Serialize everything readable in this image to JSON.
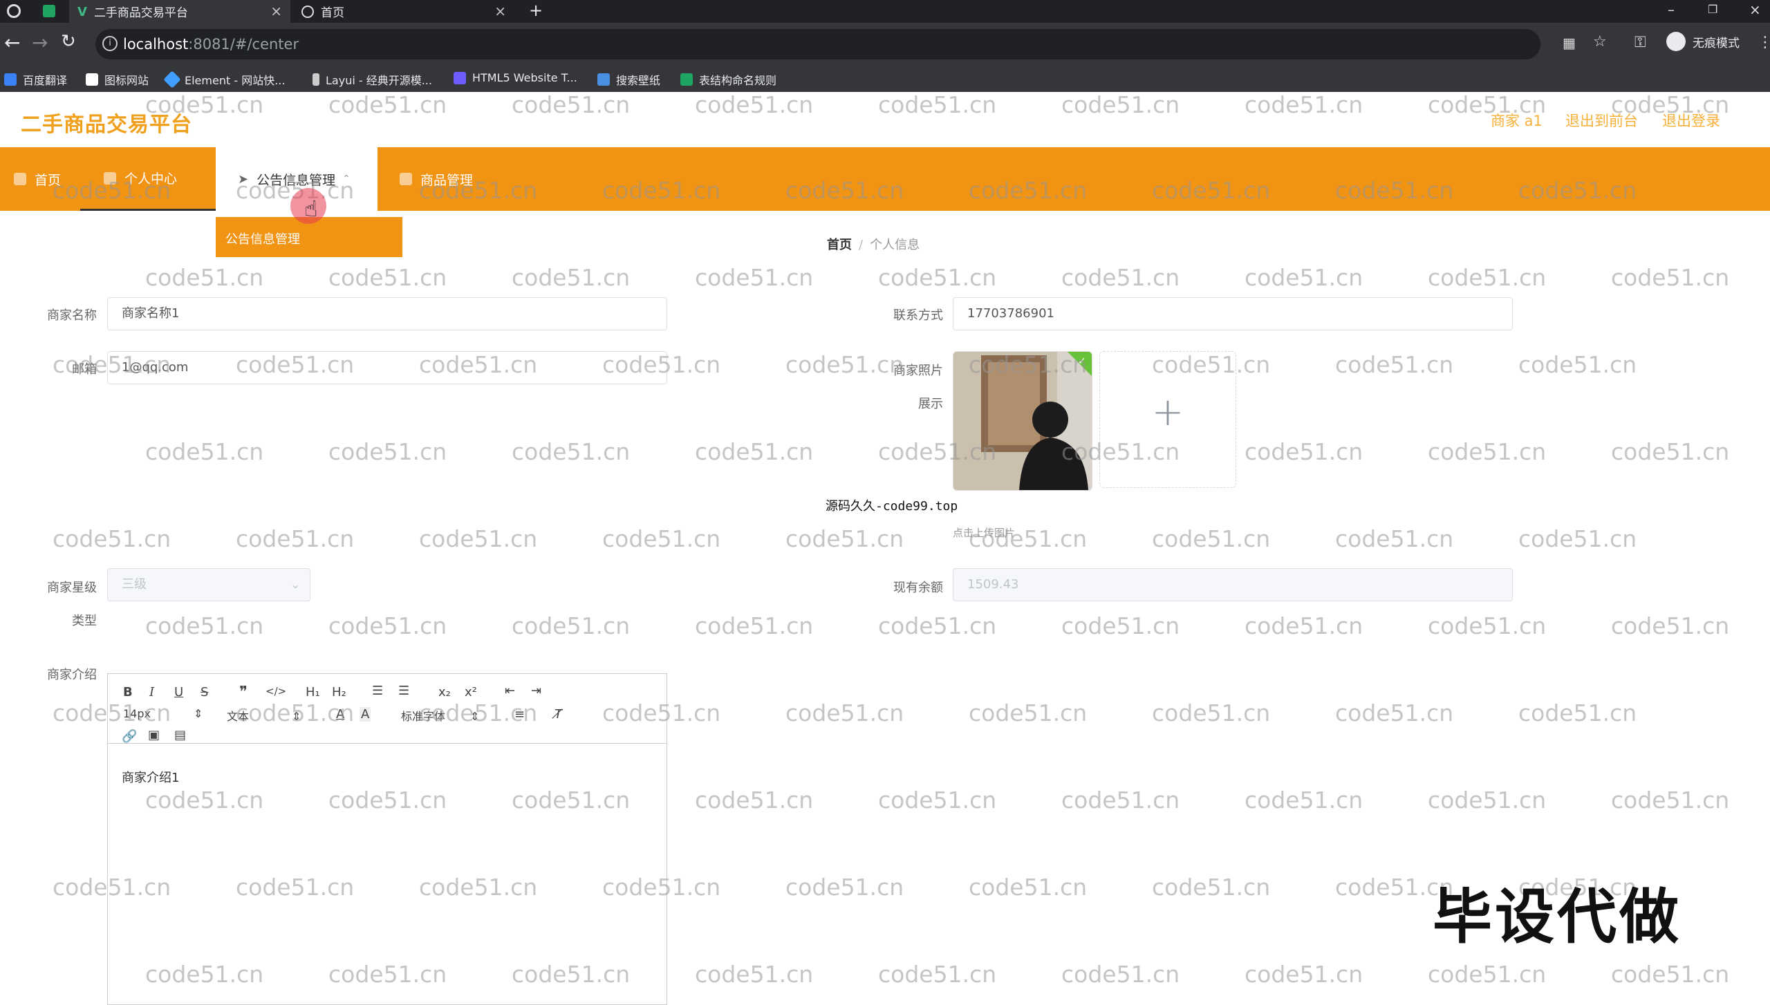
{
  "browser": {
    "tabs": [
      {
        "title": "二手商品交易平台",
        "active": true
      },
      {
        "title": "首页",
        "active": false
      }
    ],
    "new_tab": "+",
    "url_host": "localhost",
    "url_path": ":8081/#/center",
    "profile_label": "无痕模式",
    "bookmarks": [
      "百度翻译",
      "图标网站",
      "Element - 网站快...",
      "Layui - 经典开源模...",
      "HTML5 Website T...",
      "搜索壁纸",
      "表结构命名规则"
    ]
  },
  "header": {
    "site_title": "二手商品交易平台",
    "user": "商家 a1",
    "back_front": "退出到前台",
    "logout": "退出登录"
  },
  "nav": {
    "items": [
      "首页",
      "个人中心",
      "公告信息管理",
      "商品管理"
    ],
    "dropdown_item": "公告信息管理"
  },
  "breadcrumb": {
    "home": "首页",
    "separator": "/",
    "current": "个人信息"
  },
  "form": {
    "name_label": "商家名称",
    "name_value": "商家名称1",
    "email_label": "邮箱",
    "email_value": "1@qq.com",
    "contact_label": "联系方式",
    "contact_value": "17703786901",
    "photo_label": "商家照片",
    "photo_label2": "展示",
    "upload_plus": "+",
    "upload_hint": "点击上传图片",
    "level_label": "商家星级",
    "level_label2": "类型",
    "level_value": "三级",
    "balance_label": "现有余额",
    "balance_value": "1509.43",
    "intro_label": "商家介绍"
  },
  "editor": {
    "font_size": "14px",
    "text_type": "文本",
    "font_family": "标准字体",
    "content": "商家介绍1"
  },
  "overlay_text": "源码久久-code99.top",
  "watermark": {
    "text": "code51.cn",
    "big": "毕设代做"
  },
  "colors": {
    "accent": "#f19313",
    "title": "#f0a01c"
  }
}
